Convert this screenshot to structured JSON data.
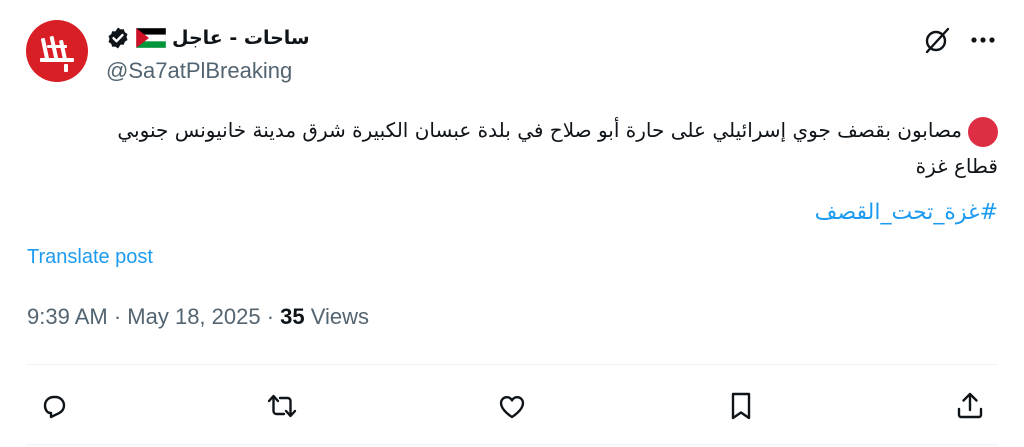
{
  "author": {
    "name": "ساحات - عاجل",
    "handle": "@Sa7atPlBreaking",
    "avatar_icon": "sa7at-logo",
    "flag_icon": "palestine-flag-icon",
    "verified_icon": "verified-badge-icon"
  },
  "tweet": {
    "text": "مصابون بقصف جوي إسرائيلي على حارة أبو صلاح في بلدة عبسان الكبيرة شرق مدينة خانيونس جنوبي قطاع غزة",
    "emoji": "red-circle",
    "hashtag": "#غزة_تحت_القصف"
  },
  "translate_label": "Translate post",
  "meta": {
    "time": "9:39 AM",
    "separator": " · ",
    "date": "May 18, 2025",
    "views_count": "35",
    "views_label": " Views"
  },
  "colors": {
    "accent": "#1d9bf0",
    "secondary_text": "#536471",
    "avatar_bg": "#d81f26",
    "red_dot": "#dd2e44"
  },
  "actions": [
    "reply-icon",
    "retweet-icon",
    "like-icon",
    "bookmark-icon",
    "share-icon"
  ]
}
